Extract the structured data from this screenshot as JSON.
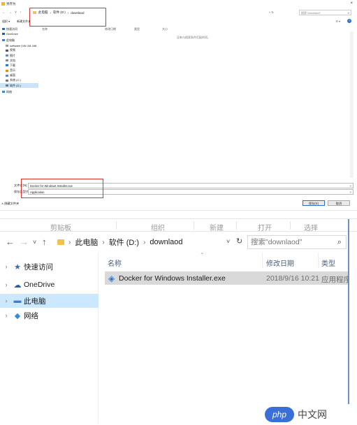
{
  "save_dialog": {
    "title": "另存为",
    "close_glyph": "×",
    "nav_arrows": [
      "←",
      "→",
      "˅",
      "↑"
    ],
    "path": [
      "此电脑",
      "软件 (D:)",
      "downlaod"
    ],
    "search_placeholder": "搜索\"downlaod\"",
    "toolbar": {
      "organize": "组织 ▾",
      "new_folder": "新建文件夹"
    },
    "nav_items": [
      {
        "label": "快速访问",
        "icon": "star-icon"
      },
      {
        "label": "OneDrive",
        "icon": "cloud-icon"
      },
      {
        "label": "此电脑",
        "icon": "computer-icon"
      },
      {
        "label": "software (\\\\W-1M-168",
        "icon": "network-drive-icon"
      },
      {
        "label": "视频",
        "icon": "video-folder-icon"
      },
      {
        "label": "图片",
        "icon": "pictures-folder-icon"
      },
      {
        "label": "文档",
        "icon": "documents-folder-icon"
      },
      {
        "label": "下载",
        "icon": "download-folder-icon"
      },
      {
        "label": "音乐",
        "icon": "music-folder-icon"
      },
      {
        "label": "桌面",
        "icon": "desktop-folder-icon"
      },
      {
        "label": "系统 (C:)",
        "icon": "drive-icon"
      },
      {
        "label": "软件 (D:)",
        "icon": "drive-icon"
      },
      {
        "label": "网络",
        "icon": "network-icon"
      }
    ],
    "columns": [
      "名称",
      "修改日期",
      "类型",
      "大小"
    ],
    "empty_message": "没有与搜索条件匹配的项。",
    "filename_label": "文件名(N):",
    "filename_value": "Docker for Windows Installer.exe",
    "filetype_label": "保存类型(T):",
    "filetype_value": "Application",
    "hide_folders": "∧ 隐藏文件夹",
    "save_button": "保存(S)",
    "cancel_button": "取消"
  },
  "explorer": {
    "ribbon": [
      "剪贴板",
      "组织",
      "新建",
      "打开",
      "选择"
    ],
    "path": [
      "此电脑",
      "软件 (D:)",
      "downlaod"
    ],
    "search_placeholder": "搜索\"downlaod\"",
    "nav_items": [
      {
        "label": "快速访问",
        "icon": "star-icon"
      },
      {
        "label": "OneDrive",
        "icon": "cloud-icon"
      },
      {
        "label": "此电脑",
        "icon": "computer-icon"
      },
      {
        "label": "网络",
        "icon": "network-icon"
      }
    ],
    "columns": [
      "名称",
      "修改日期",
      "类型"
    ],
    "files": [
      {
        "name": "Docker for Windows Installer.exe",
        "modified": "2018/9/16 10:21",
        "type": "应用程序"
      }
    ]
  },
  "watermark": {
    "pill": "php",
    "text": "中文网"
  },
  "colors": {
    "highlight_red": "#e0302a",
    "selection_blue": "#cce8ff",
    "accent_blue": "#2a6fd6"
  }
}
